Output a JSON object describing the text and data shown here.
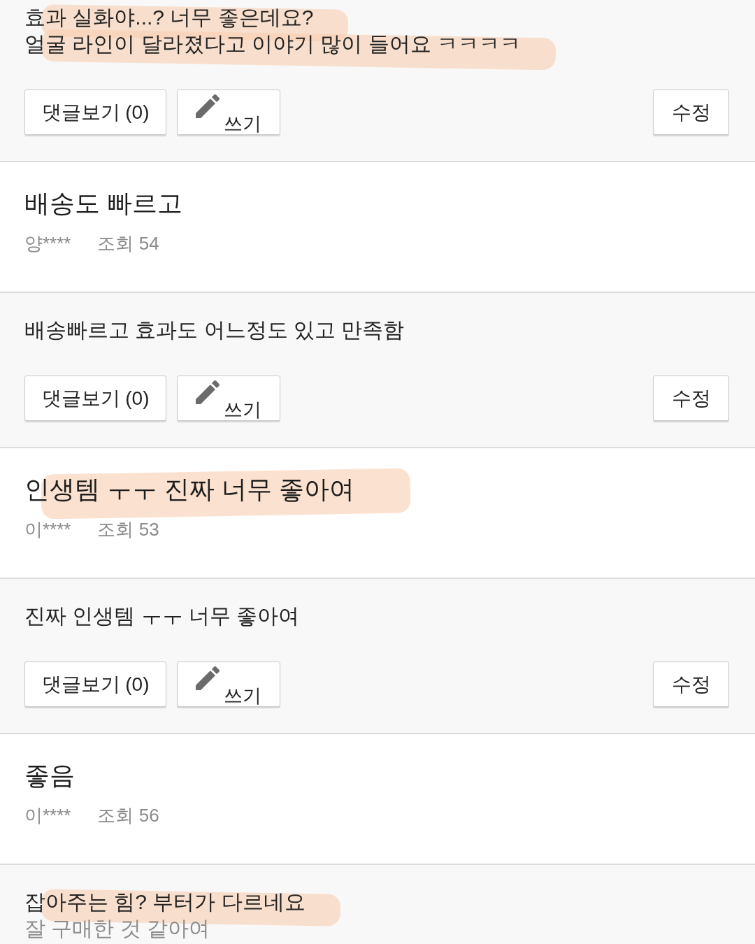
{
  "review_sections": [
    {
      "kind": "body",
      "lines": [
        {
          "text": "효과 실화야...? 너무 좋은데요?",
          "greyed": false,
          "highlighted": true
        },
        {
          "text": "얼굴 라인이 달라졌다고 이야기 많이 들어요 ㅋㅋㅋㅋ",
          "greyed": false,
          "highlighted": true
        }
      ],
      "buttons": {
        "comments": "댓글보기 (0)",
        "write": "쓰기",
        "edit": "수정"
      }
    },
    {
      "kind": "header",
      "title": "배송도 빠르고",
      "highlighted": false,
      "author": "양****",
      "views": "조회 54"
    },
    {
      "kind": "body",
      "lines": [
        {
          "text": "배송빠르고 효과도 어느정도 있고 만족함",
          "greyed": false,
          "highlighted": false
        }
      ],
      "buttons": {
        "comments": "댓글보기 (0)",
        "write": "쓰기",
        "edit": "수정"
      }
    },
    {
      "kind": "header",
      "title": "인생템 ㅜㅜ 진짜 너무 좋아여",
      "highlighted": true,
      "author": "이****",
      "views": "조회 53"
    },
    {
      "kind": "body",
      "lines": [
        {
          "text": "진짜 인생템 ㅜㅜ 너무 좋아여",
          "greyed": false,
          "highlighted": false
        }
      ],
      "buttons": {
        "comments": "댓글보기 (0)",
        "write": "쓰기",
        "edit": "수정"
      }
    },
    {
      "kind": "header",
      "title": "좋음",
      "highlighted": false,
      "author": "이****",
      "views": "조회 56"
    },
    {
      "kind": "body",
      "lines": [
        {
          "text": "잡아주는 힘? 부터가 다르네요",
          "greyed": false,
          "highlighted": true
        },
        {
          "text": "잘 구매한 것 같아여",
          "greyed": true,
          "highlighted": false
        }
      ]
    }
  ]
}
